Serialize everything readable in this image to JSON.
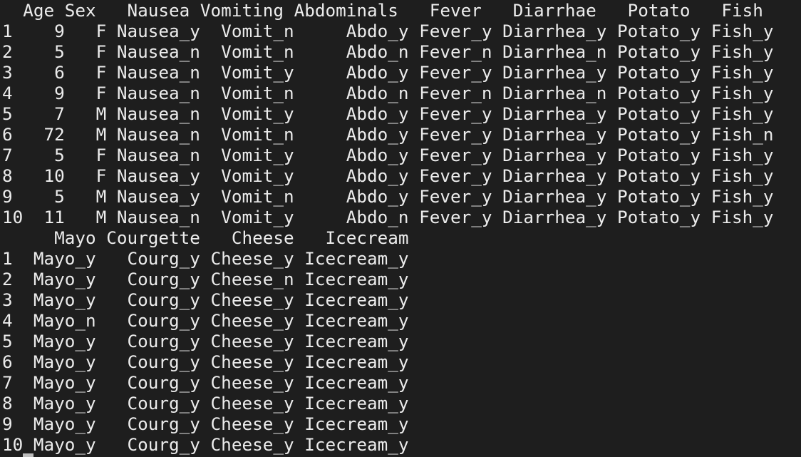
{
  "console": {
    "lines": [
      "  Age Sex   Nausea Vomiting Abdominals   Fever   Diarrhae   Potato   Fish",
      "1    9   F Nausea_y  Vomit_n     Abdo_y Fever_y Diarrhea_y Potato_y Fish_y",
      "2    5   F Nausea_n  Vomit_n     Abdo_n Fever_n Diarrhea_n Potato_y Fish_y",
      "3    6   F Nausea_n  Vomit_y     Abdo_y Fever_y Diarrhea_y Potato_y Fish_y",
      "4    9   F Nausea_n  Vomit_n     Abdo_n Fever_n Diarrhea_n Potato_y Fish_y",
      "5    7   M Nausea_n  Vomit_y     Abdo_y Fever_y Diarrhea_y Potato_y Fish_y",
      "6   72   M Nausea_n  Vomit_n     Abdo_y Fever_y Diarrhea_y Potato_y Fish_n",
      "7    5   F Nausea_n  Vomit_y     Abdo_y Fever_y Diarrhea_y Potato_y Fish_y",
      "8   10   F Nausea_y  Vomit_y     Abdo_y Fever_y Diarrhea_y Potato_y Fish_y",
      "9    5   M Nausea_y  Vomit_n     Abdo_y Fever_y Diarrhea_y Potato_y Fish_y",
      "10  11   M Nausea_n  Vomit_y     Abdo_n Fever_y Diarrhea_y Potato_y Fish_y",
      "     Mayo Courgette   Cheese   Icecream",
      "1  Mayo_y   Courg_y Cheese_y Icecream_y",
      "2  Mayo_y   Courg_y Cheese_n Icecream_y",
      "3  Mayo_y   Courg_y Cheese_y Icecream_y",
      "4  Mayo_n   Courg_y Cheese_y Icecream_y",
      "5  Mayo_y   Courg_y Cheese_y Icecream_y",
      "6  Mayo_y   Courg_y Cheese_y Icecream_y",
      "7  Mayo_y   Courg_y Cheese_y Icecream_y",
      "8  Mayo_y   Courg_y Cheese_y Icecream_y",
      "9  Mayo_y   Courg_y Cheese_y Icecream_y",
      "10 Mayo_y   Courg_y Cheese_y Icecream_y"
    ]
  },
  "colors": {
    "background": "#1e1e1e",
    "text": "#ececec",
    "cursor": "#bdbdbd"
  }
}
